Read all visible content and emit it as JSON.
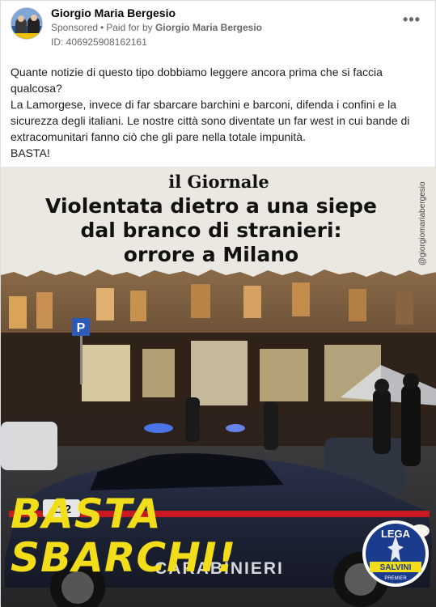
{
  "ad": {
    "page_name": "Giorgio Maria Bergesio",
    "sponsored": "Sponsored",
    "separator": "•",
    "paid_for_prefix": "Paid for by",
    "paid_for_name": "Giorgio Maria Bergesio",
    "id_label": "ID: 406925908162161",
    "more_label": "•••"
  },
  "post": {
    "lines": [
      "Quante notizie di questo tipo dobbiamo leggere ancora prima che si faccia qualcosa?",
      "La Lamorgese, invece di far sbarcare barchini e barconi, difenda i confini e la sicurezza degli italiani. Le nostre città sono diventate un far west in cui bande di extracomunitari fanno ciò che gli pare nella totale impunità.",
      "BASTA!"
    ]
  },
  "creative": {
    "newspaper": "il Giornale",
    "headline": [
      "Violentata dietro a una siepe",
      "dal branco di stranieri:",
      "orrore a Milano"
    ],
    "watermark": "@giorgiomariabergesio",
    "car_number": "112",
    "car_text": "CARABINIERI",
    "slogan": [
      "BASTA",
      "SBARCHI!"
    ],
    "logo_top": "LEGA",
    "logo_band": "SALVINI",
    "logo_bottom": "PREMIER",
    "colors": {
      "slogan_yellow": "#f2dd1a",
      "banner_blue": "#2a37a8",
      "lega_blue": "#1b3b8c",
      "car_body": "#1c2235",
      "car_stripe": "#c7191f"
    }
  }
}
